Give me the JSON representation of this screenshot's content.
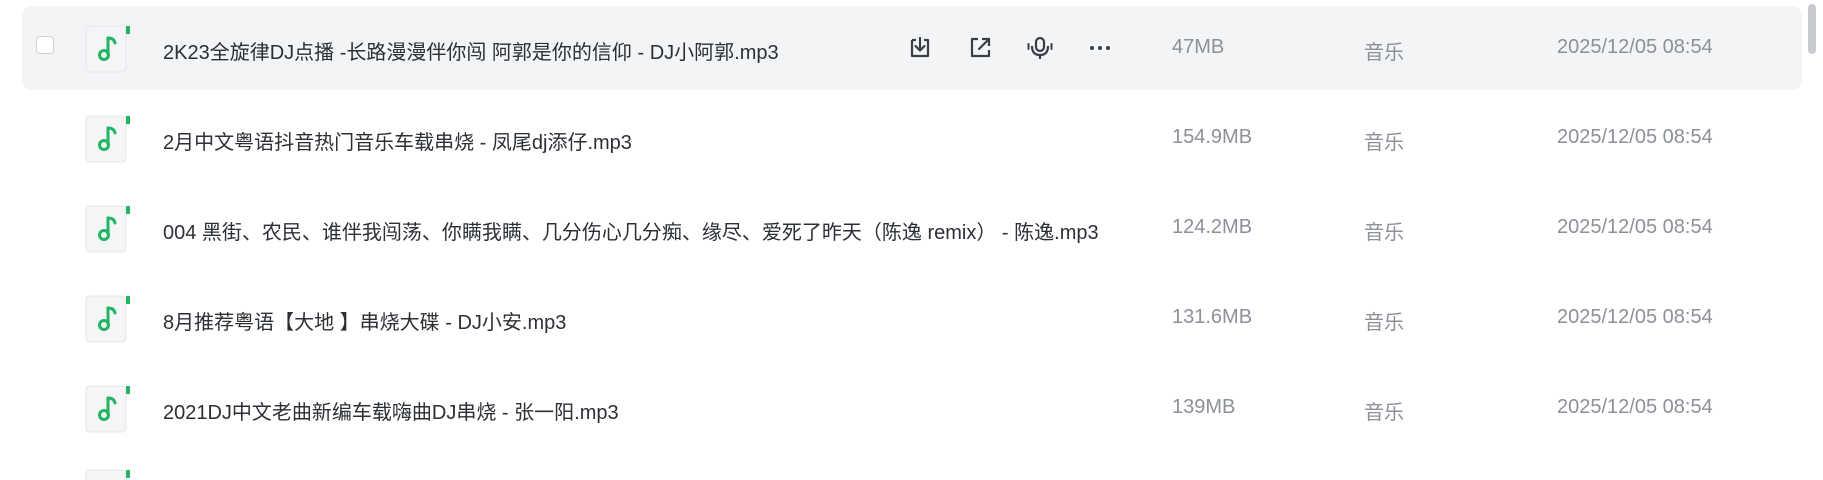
{
  "files": [
    {
      "name": "2K23全旋律DJ点播 -长路漫漫伴你闯 阿郭是你的信仰 - DJ小阿郭.mp3",
      "size": "47MB",
      "type": "音乐",
      "date": "2025/12/05 08:54",
      "icon": "music-note-icon"
    },
    {
      "name": "2月中文粤语抖音热门音乐车载串烧 - 凤尾dj添仔.mp3",
      "size": "154.9MB",
      "type": "音乐",
      "date": "2025/12/05 08:54",
      "icon": "music-note-icon"
    },
    {
      "name": "004 黑街、农民、谁伴我闯荡、你瞒我瞒、几分伤心几分痴、缘尽、爱死了昨天（陈逸 remix） - 陈逸.mp3",
      "size": "124.2MB",
      "type": "音乐",
      "date": "2025/12/05 08:54",
      "icon": "music-note-icon"
    },
    {
      "name": "8月推荐粤语【大地 】串烧大碟 - DJ小安.mp3",
      "size": "131.6MB",
      "type": "音乐",
      "date": "2025/12/05 08:54",
      "icon": "music-note-icon"
    },
    {
      "name": "2021DJ中文老曲新编车载嗨曲DJ串烧 - 张一阳.mp3",
      "size": "139MB",
      "type": "音乐",
      "date": "2025/12/05 08:54",
      "icon": "music-note-icon"
    }
  ],
  "row_actions": [
    {
      "icon": "download-icon"
    },
    {
      "icon": "share-icon"
    },
    {
      "icon": "speech-to-text-icon"
    },
    {
      "icon": "more-icon"
    }
  ],
  "colors": {
    "accent": "#22b563",
    "icon_bg": "#f4f5f6",
    "hover_bg": "#f3f4f6",
    "text_primary": "#2b2f36",
    "text_secondary": "#8c9099"
  }
}
